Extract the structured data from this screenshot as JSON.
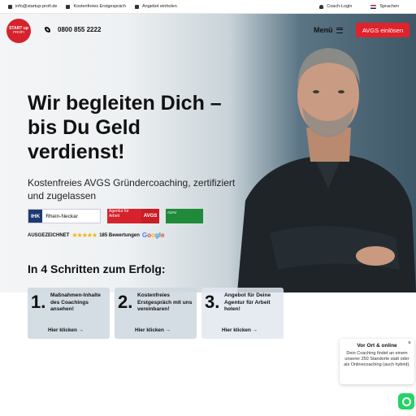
{
  "topbar": {
    "email": "info@startup-profi.de",
    "consult": "Kostenfreies Erstgespräch",
    "offer": "Angebot einholen",
    "coach_login": "Coach-Login",
    "language": "Sprachen"
  },
  "header": {
    "logo_line1": "START up",
    "logo_line2": "PROFI",
    "phone": "0800 855 2222",
    "menu_label": "Menü",
    "cta_label": "AVGS einlösen"
  },
  "hero": {
    "headline_1": "Wir begleiten Dich –",
    "headline_2": "bis Du Geld",
    "headline_3": "verdienst!",
    "subline": "Kostenfreies AVGS Gründercoaching, zertifiziert und zugelassen"
  },
  "badges": {
    "ihk_abbr": "IHK",
    "ihk_region": "Rhein-Neckar",
    "aa_text": "Agentur für Arbeit",
    "aa_tag": "AVGS",
    "azav_text": "AZAV"
  },
  "ratings": {
    "label": "AUSGEZEICHNET",
    "stars": "★★★★★",
    "count": "185 Bewertungen",
    "g1": "G",
    "g2": "o",
    "g3": "o",
    "g4": "g",
    "g5": "l",
    "g6": "e"
  },
  "steps": {
    "title": "In 4 Schritten zum Erfolg:",
    "items": [
      {
        "num": "1.",
        "text": "Maßnahmen-Inhalte des Coachings ansehen!",
        "link": "Hier klicken"
      },
      {
        "num": "2.",
        "text": "Kostenfreies Erstgespräch mit uns vereinbaren!",
        "link": "Hier klicken"
      },
      {
        "num": "3.",
        "text": "Angebot für Deine Agentur für Arbeit holen!",
        "link": "Hier klicken"
      }
    ]
  },
  "popup": {
    "title": "Vor Ort & online",
    "body": "Dein Coaching findet an einem unserer 250 Standorte statt oder als Onlinecoaching (auch hybrid).",
    "close": "×"
  },
  "colors": {
    "brand_red": "#e0222c",
    "whatsapp_green": "#25d366"
  }
}
